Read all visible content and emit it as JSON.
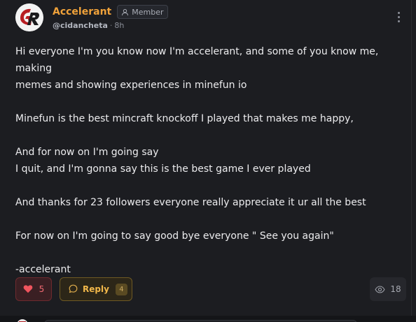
{
  "author": {
    "name": "Accelerant",
    "role": "Member",
    "handle": "@cidancheta",
    "separator": "·",
    "time": "8h"
  },
  "post": {
    "paragraphs": [
      "Hi everyone I'm you know now I'm accelerant, and some of you know me, making\nmemes and showing experiences in minefun io",
      "Minefun is the best mincraft knockoff I played that makes me happy,",
      "And for now on I'm going say\nI quit, and I'm gonna say this is the best game I ever played",
      "And thanks for 23 followers everyone really appreciate it ur all the best",
      "For now on I'm going to say good bye everyone \" See you again\"",
      "-accelerant"
    ]
  },
  "actions": {
    "like_count": "5",
    "reply_label": "Reply",
    "reply_count": "4",
    "view_count": "18"
  },
  "icons": {
    "avatar_logo": "gr-logo-icon",
    "role": "user-icon",
    "more": "more-vertical-icon",
    "like": "heart-icon",
    "reply": "chat-bubble-icon",
    "views": "eye-icon"
  },
  "colors": {
    "author_name": "#f0a23a",
    "like_accent": "#f06a72",
    "reply_accent": "#f2b84a",
    "background": "#1c1d21"
  }
}
